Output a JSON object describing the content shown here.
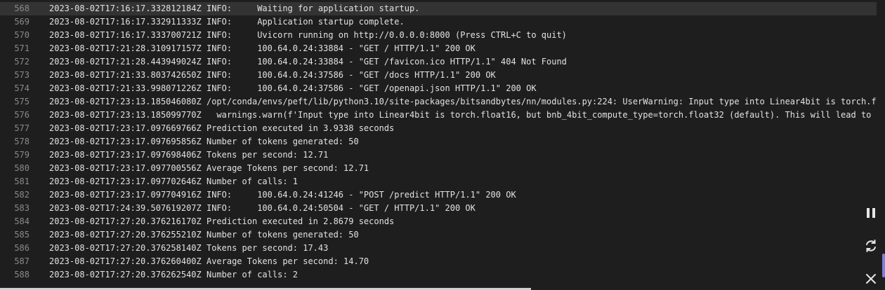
{
  "log": {
    "lines": [
      {
        "n": "568",
        "text": "2023-08-02T17:16:17.332812184Z INFO:     Waiting for application startup.",
        "highlight": true
      },
      {
        "n": "569",
        "text": "2023-08-02T17:16:17.332911333Z INFO:     Application startup complete."
      },
      {
        "n": "570",
        "text": "2023-08-02T17:16:17.333700721Z INFO:     Uvicorn running on http://0.0.0.0:8000 (Press CTRL+C to quit)"
      },
      {
        "n": "571",
        "text": "2023-08-02T17:21:28.310917157Z INFO:     100.64.0.24:33884 - \"GET / HTTP/1.1\" 200 OK"
      },
      {
        "n": "572",
        "text": "2023-08-02T17:21:28.443949024Z INFO:     100.64.0.24:33884 - \"GET /favicon.ico HTTP/1.1\" 404 Not Found"
      },
      {
        "n": "573",
        "text": "2023-08-02T17:21:33.803742650Z INFO:     100.64.0.24:37586 - \"GET /docs HTTP/1.1\" 200 OK"
      },
      {
        "n": "574",
        "text": "2023-08-02T17:21:33.998071226Z INFO:     100.64.0.24:37586 - \"GET /openapi.json HTTP/1.1\" 200 OK"
      },
      {
        "n": "575",
        "text": "2023-08-02T17:23:13.185046080Z /opt/conda/envs/peft/lib/python3.10/site-packages/bitsandbytes/nn/modules.py:224: UserWarning: Input type into Linear4bit is torch.f"
      },
      {
        "n": "576",
        "text": "2023-08-02T17:23:13.185099770Z   warnings.warn(f'Input type into Linear4bit is torch.float16, but bnb_4bit_compute_type=torch.float32 (default). This will lead to s"
      },
      {
        "n": "577",
        "text": "2023-08-02T17:23:17.097669766Z Prediction executed in 3.9338 seconds"
      },
      {
        "n": "578",
        "text": "2023-08-02T17:23:17.097695856Z Number of tokens generated: 50"
      },
      {
        "n": "579",
        "text": "2023-08-02T17:23:17.097698406Z Tokens per second: 12.71"
      },
      {
        "n": "580",
        "text": "2023-08-02T17:23:17.097700556Z Average Tokens per second: 12.71"
      },
      {
        "n": "581",
        "text": "2023-08-02T17:23:17.097702646Z Number of calls: 1"
      },
      {
        "n": "582",
        "text": "2023-08-02T17:23:17.097704916Z INFO:     100.64.0.24:41246 - \"POST /predict HTTP/1.1\" 200 OK"
      },
      {
        "n": "583",
        "text": "2023-08-02T17:24:39.507619207Z INFO:     100.64.0.24:50504 - \"GET / HTTP/1.1\" 200 OK"
      },
      {
        "n": "584",
        "text": "2023-08-02T17:27:20.376216170Z Prediction executed in 2.8679 seconds"
      },
      {
        "n": "585",
        "text": "2023-08-02T17:27:20.376255210Z Number of tokens generated: 50"
      },
      {
        "n": "586",
        "text": "2023-08-02T17:27:20.376258140Z Tokens per second: 17.43"
      },
      {
        "n": "587",
        "text": "2023-08-02T17:27:20.376260400Z Average Tokens per second: 14.70"
      },
      {
        "n": "588",
        "text": "2023-08-02T17:27:20.376262540Z Number of calls: 2"
      }
    ]
  },
  "controls": {
    "pause_icon": "pause-icon",
    "refresh_icon": "refresh-icon",
    "close_icon": "close-icon"
  },
  "colors": {
    "background": "#1e1e1e",
    "highlight": "#333333",
    "line_number": "#8a8a8a",
    "text": "#e2e2e2"
  }
}
